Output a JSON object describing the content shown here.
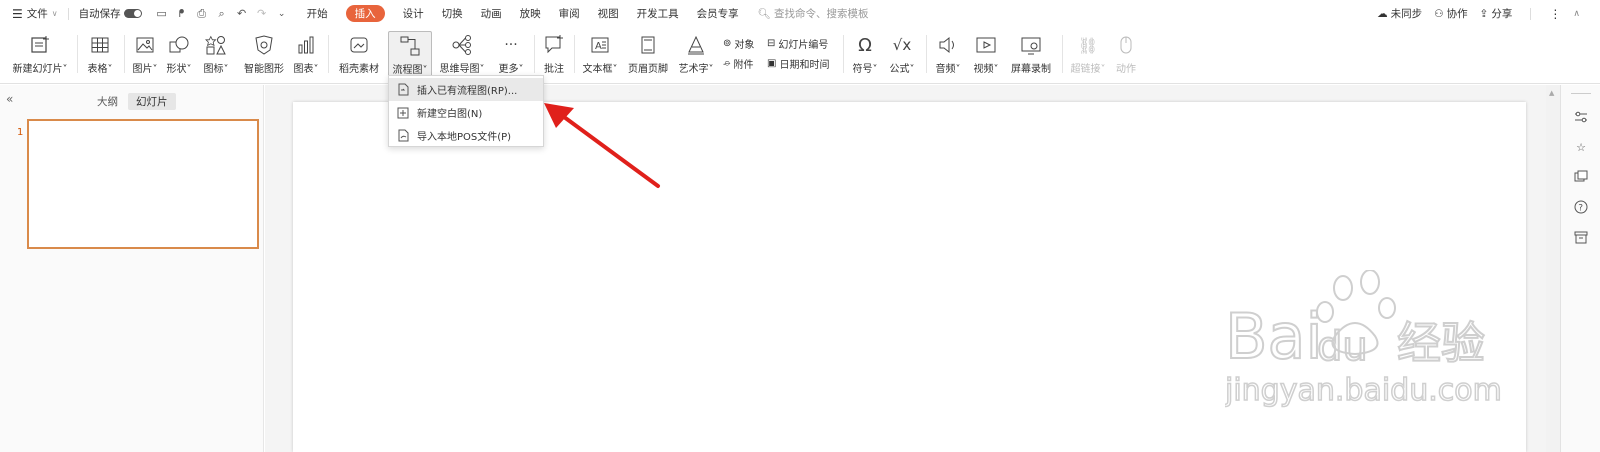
{
  "menubar": {
    "file": "文件",
    "autosave": "自动保存",
    "tabs": [
      "开始",
      "插入",
      "设计",
      "切换",
      "动画",
      "放映",
      "审阅",
      "视图",
      "开发工具",
      "会员专享"
    ],
    "active_tab": "插入",
    "search_placeholder": "查找命令、搜索模板",
    "right": {
      "sync": "未同步",
      "collab": "协作",
      "share": "分享"
    }
  },
  "ribbon": {
    "new_slide": "新建幻灯片",
    "table": "表格",
    "picture": "图片",
    "shape": "形状",
    "icon": "图标",
    "smartart": "智能图形",
    "chart": "图表",
    "assets": "稻壳素材",
    "flowchart": "流程图",
    "mindmap": "思维导图",
    "more": "更多",
    "comment": "批注",
    "textbox": "文本框",
    "header_footer": "页眉页脚",
    "wordart": "艺术字",
    "object": "对象",
    "slide_number": "幻灯片编号",
    "attachment": "附件",
    "datetime": "日期和时间",
    "symbol": "符号",
    "formula": "公式",
    "audio": "音频",
    "video": "视频",
    "screen_record": "屏幕录制",
    "hyperlink": "超链接",
    "action": "动作"
  },
  "dropdown": {
    "items": [
      "插入已有流程图(RP)...",
      "新建空白图(N)",
      "导入本地POS文件(P)"
    ]
  },
  "left_panel": {
    "tabs": [
      "大纲",
      "幻灯片"
    ],
    "active_tab": "幻灯片",
    "slide_number": "1"
  },
  "watermark": {
    "brand": "Bai",
    "brand2": "du",
    "cn": "经验",
    "url": "jingyan.baidu.com"
  },
  "colors": {
    "accent": "#e8643c",
    "arrow": "#e0201b",
    "thumb_border": "#d98a4a"
  }
}
